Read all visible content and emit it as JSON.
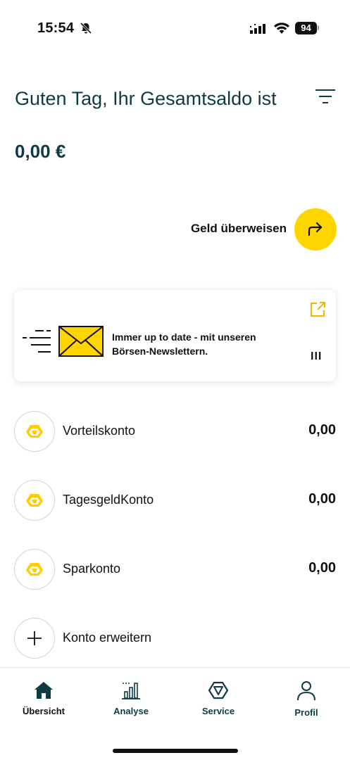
{
  "status_bar": {
    "time": "15:54",
    "battery": "94"
  },
  "header": {
    "greeting": "Guten Tag, Ihr Gesamtsaldo ist",
    "balance": "0,00 €"
  },
  "transfer": {
    "label": "Geld überweisen"
  },
  "newsletter": {
    "text": "Immer up to date - mit unseren Börsen-Newslettern."
  },
  "accounts": [
    {
      "name": "Vorteilskonto",
      "amount": "0,00"
    },
    {
      "name": "TagesgeldKonto",
      "amount": "0,00"
    },
    {
      "name": "Sparkonto",
      "amount": "0,00"
    }
  ],
  "extend": {
    "label": "Konto erweitern"
  },
  "nav": {
    "items": [
      {
        "label": "Übersicht",
        "icon": "home-icon",
        "active": true
      },
      {
        "label": "Analyse",
        "icon": "analytics-icon",
        "active": false
      },
      {
        "label": "Service",
        "icon": "service-icon",
        "active": false
      },
      {
        "label": "Profil",
        "icon": "profile-icon",
        "active": false
      }
    ]
  },
  "colors": {
    "accent_yellow": "#ffd500",
    "text_dark_teal": "#0e3a45"
  }
}
